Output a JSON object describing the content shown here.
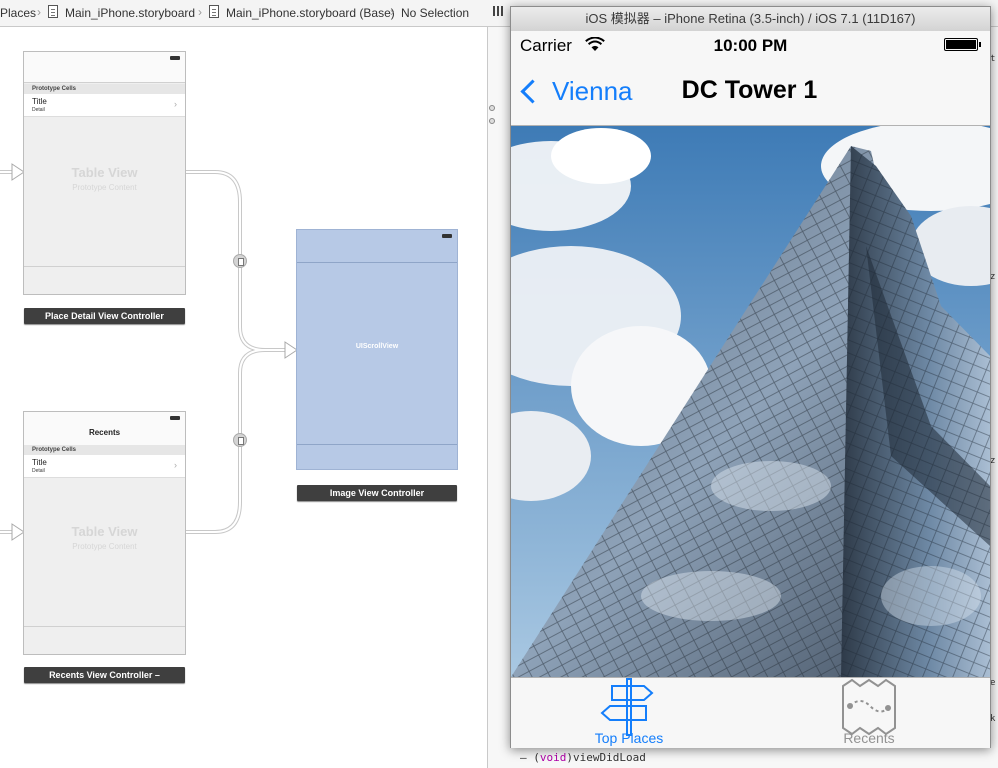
{
  "jumpbar": {
    "crumbs": [
      "Places",
      "Main_iPhone.storyboard",
      "Main_iPhone.storyboard (Base)",
      "No Selection"
    ]
  },
  "storyboard": {
    "place_detail": {
      "prototype_header": "Prototype Cells",
      "cell_title": "Title",
      "cell_detail": "Detail",
      "table_title": "Table View",
      "table_sub": "Prototype Content",
      "label": "Place Detail View Controller"
    },
    "recents": {
      "nav_title": "Recents",
      "prototype_header": "Prototype Cells",
      "cell_title": "Title",
      "cell_detail": "Detail",
      "table_title": "Table View",
      "table_sub": "Prototype Content",
      "label": "Recents View Controller –"
    },
    "image": {
      "content": "UIScrollView",
      "label": "Image View Controller"
    }
  },
  "simulator": {
    "window_title": "iOS 模拟器 – iPhone Retina (3.5-inch) / iOS 7.1 (11D167)",
    "status": {
      "carrier": "Carrier",
      "time": "10:00 PM"
    },
    "nav": {
      "back_label": "Vienna",
      "title": "DC Tower 1"
    },
    "tabs": [
      {
        "label": "Top Places",
        "icon": "signpost-icon",
        "selected": true
      },
      {
        "label": "Recents",
        "icon": "map-icon",
        "selected": false
      }
    ],
    "tint_color": "#147efb",
    "inactive_color": "#929292"
  },
  "code": {
    "keyword": "void",
    "prefix": "– (",
    "suffix": ")viewDidLoad"
  }
}
